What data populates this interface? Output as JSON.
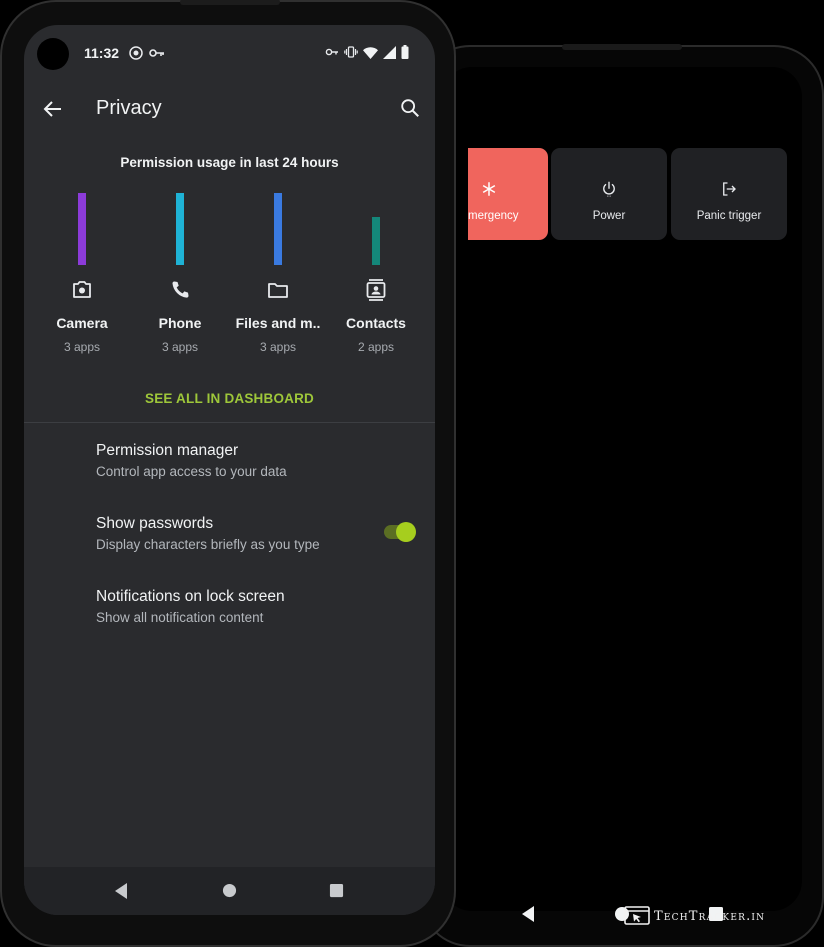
{
  "back_phone": {
    "tiles": [
      {
        "label": "mergency",
        "icon": "asterisk-icon",
        "color": "#f0655d"
      },
      {
        "label": "Power",
        "icon": "power-icon"
      },
      {
        "label": "Panic trigger",
        "icon": "logout-icon"
      }
    ]
  },
  "status_bar": {
    "time": "11:32"
  },
  "app_bar": {
    "title": "Privacy"
  },
  "usage": {
    "title": "Permission usage in last 24 hours",
    "dashboard_link": "SEE ALL IN DASHBOARD",
    "link_color": "#9ec73a",
    "max_apps": 3,
    "permissions": [
      {
        "name": "Camera",
        "count_label": "3 apps",
        "count": 3,
        "color": "#8c3bd9",
        "icon": "camera-icon"
      },
      {
        "name": "Phone",
        "count_label": "3 apps",
        "count": 3,
        "color": "#1fb3d6",
        "icon": "phone-icon"
      },
      {
        "name": "Files and m..",
        "count_label": "3 apps",
        "count": 3,
        "color": "#3a7ae0",
        "icon": "folder-icon"
      },
      {
        "name": "Contacts",
        "count_label": "2 apps",
        "count": 2,
        "color": "#14877a",
        "icon": "contacts-icon"
      }
    ]
  },
  "settings": [
    {
      "title": "Permission manager",
      "subtitle": "Control app access to your data"
    },
    {
      "title": "Show passwords",
      "subtitle": "Display characters briefly as you type",
      "toggle": true
    },
    {
      "title": "Notifications on lock screen",
      "subtitle": "Show all notification content"
    }
  ],
  "accent_color": "#a6ce1e",
  "watermark": {
    "text": "TechTracker.in"
  }
}
